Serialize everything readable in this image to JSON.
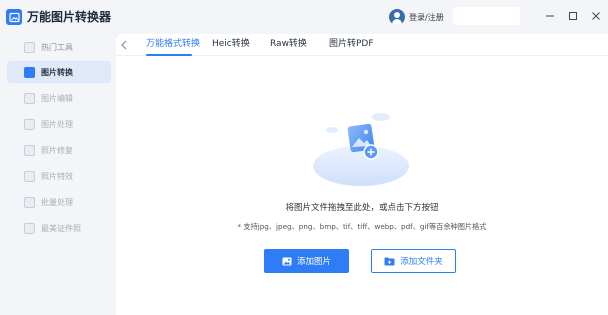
{
  "app": {
    "title": "万能图片转换器",
    "accent_color": "#2f7df6",
    "logo_icon": "app-logo-icon"
  },
  "header": {
    "login_label": "登录/注册",
    "avatar_icon": "user-avatar-icon",
    "window_controls": [
      "minimize-icon",
      "maximize-icon",
      "close-icon"
    ]
  },
  "sidebar": {
    "items": [
      {
        "label": "热门工具",
        "active": false
      },
      {
        "label": "图片转换",
        "active": true
      },
      {
        "label": "图片编辑",
        "active": false
      },
      {
        "label": "图片处理",
        "active": false
      },
      {
        "label": "照片修复",
        "active": false
      },
      {
        "label": "照片特效",
        "active": false
      },
      {
        "label": "批量处理",
        "active": false
      },
      {
        "label": "最美证件照",
        "active": false
      }
    ]
  },
  "main": {
    "tabs": [
      {
        "label": "万能格式转换",
        "active": true
      },
      {
        "label": "Heic转换",
        "active": false
      },
      {
        "label": "Raw转换",
        "active": false
      },
      {
        "label": "图片转PDF",
        "active": false
      }
    ],
    "drop_hint": "将图片文件拖拽至此处，或点击下方按钮",
    "supported_formats": "* 支持jpg、jpeg、png、bmp、tif、tiff、webp、pdf、gif等百余种图片格式",
    "add_image_label": "添加图片",
    "add_folder_label": "添加文件夹"
  }
}
